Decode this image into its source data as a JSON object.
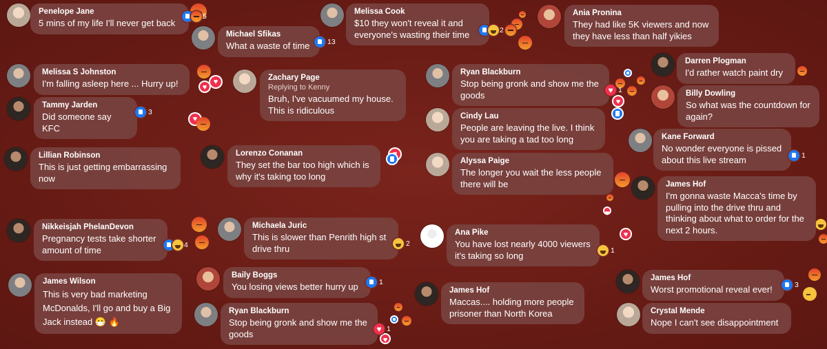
{
  "comments": [
    {
      "name": "Penelope Jane",
      "text": "5 mins of my life I'll never get back",
      "count": "5",
      "reactions": [
        "like-icon",
        "angry-icon"
      ]
    },
    {
      "name": "Michael Sfikas",
      "text": "What a waste of time",
      "count": "13",
      "reactions": [
        "like-icon"
      ]
    },
    {
      "name": "Melissa Cook",
      "text": "$10 they won't reveal it and everyone's wasting their time",
      "count": "2",
      "reactions": [
        "like-icon",
        "haha-icon",
        "angry-icon"
      ]
    },
    {
      "name": "Ania Pronina",
      "text": "They had like 5K viewers and now they have less than half yikies"
    },
    {
      "name": "Darren Plogman",
      "text": "I'd rather watch paint dry"
    },
    {
      "name": "Melissa S Johnston",
      "text": "I'm falling asleep here ... Hurry up!"
    },
    {
      "name": "Zachary Page",
      "reply": "Replying to Kenny",
      "text": "Bruh, I've vacuumed my house. This is ridiculous"
    },
    {
      "name": "Ryan Blackburn",
      "text": "Stop being gronk and show me the goods",
      "count": "1",
      "reactions": [
        "heart-icon"
      ]
    },
    {
      "name": "Billy Dowling",
      "text": "So what was the countdown for again?"
    },
    {
      "name": "Tammy Jarden",
      "text": "Did someone say KFC",
      "count": "3",
      "reactions": [
        "like-icon"
      ]
    },
    {
      "name": "Cindy Lau",
      "text": "People are leaving the live. I think you are taking a tad too long"
    },
    {
      "name": "Kane Forward",
      "text": "No wonder everyone is pissed about this live stream",
      "count": "1",
      "reactions": [
        "like-icon"
      ]
    },
    {
      "name": "Lillian Robinson",
      "text": "This is just getting embarrassing now"
    },
    {
      "name": "Lorenzo Conanan",
      "text": "They set the bar too high which is why it's taking too long"
    },
    {
      "name": "Alyssa Paige",
      "text": "The longer you wait the less people there will be"
    },
    {
      "name": "James Hof",
      "text": "I'm gonna waste Macca's time by pulling into the drive thru and thinking about what to order for the next 2 hours."
    },
    {
      "name": "Nikkeisjah PhelanDevon",
      "text": "Pregnancy tests take shorter amount of time",
      "count": "4",
      "reactions": [
        "like-icon",
        "haha-icon"
      ]
    },
    {
      "name": "Michaela Juric",
      "text": "This is slower than Penrith high st drive thru",
      "count": "2",
      "reactions": [
        "haha-icon"
      ]
    },
    {
      "name": "Ana Pike",
      "text": "You have lost nearly 4000 viewers it's taking so long",
      "count": "1",
      "reactions": [
        "haha-icon"
      ]
    },
    {
      "name": "James Wilson",
      "text": "This is very bad marketing McDonalds, I'll go and buy a Big Jack instead 😷 🔥"
    },
    {
      "name": "Baily Boggs",
      "text": "You losing views better hurry up",
      "count": "1",
      "reactions": [
        "like-icon"
      ]
    },
    {
      "name": "James Hof",
      "text": "Maccas.... holding more people prisoner than North Korea"
    },
    {
      "name": "James Hof",
      "text": "Worst promotional reveal ever!",
      "count": "3",
      "reactions": [
        "like-icon"
      ]
    },
    {
      "name": "Ryan Blackburn",
      "text": "Stop being gronk and show me the goods",
      "count": "1",
      "reactions": [
        "heart-icon"
      ]
    },
    {
      "name": "Crystal Mende",
      "text": "Nope I can't see disappointment"
    }
  ],
  "colors": {
    "background": "#6b1e17",
    "bubble": "#79423e",
    "like": "#1e78f2",
    "love": "#f0304e",
    "angry": "#e8462b"
  }
}
